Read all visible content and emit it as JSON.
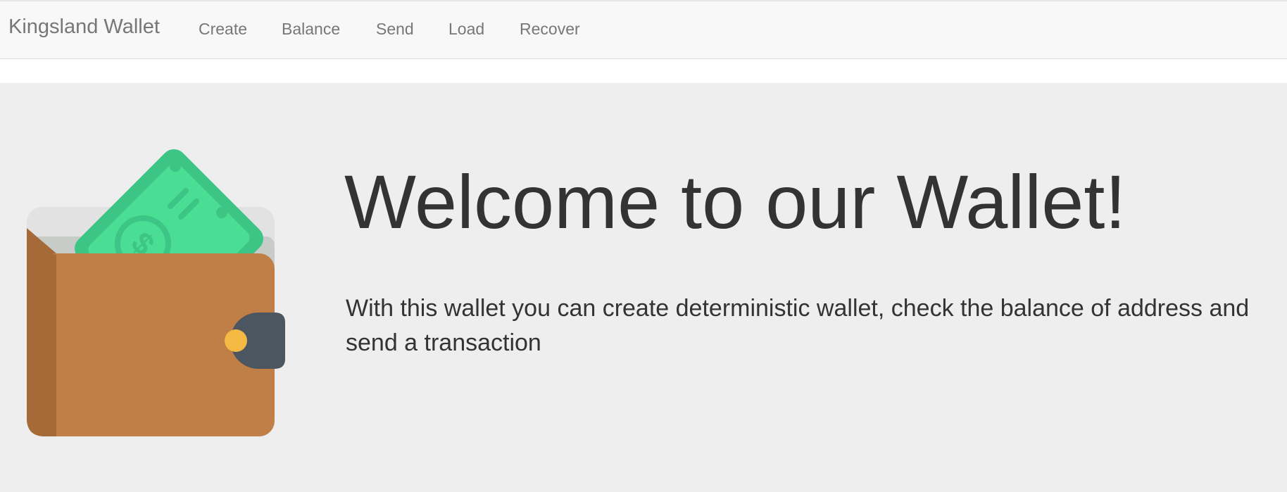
{
  "navbar": {
    "brand": "Kingsland Wallet",
    "items": [
      {
        "label": "Create"
      },
      {
        "label": "Balance"
      },
      {
        "label": "Send"
      },
      {
        "label": "Load"
      },
      {
        "label": "Recover"
      }
    ]
  },
  "hero": {
    "title": "Welcome to our Wallet!",
    "description": "With this wallet you can create deterministic wallet, check the balance of address and send a transaction",
    "illustration": "wallet-with-money-icon"
  },
  "colors": {
    "wallet_brown": "#c17f48",
    "wallet_spine": "#a56a38",
    "clasp": "#4b5660",
    "clasp_dot": "#f4b942",
    "bill_green": "#4ade94",
    "bill_dark_green": "#3cc585"
  }
}
